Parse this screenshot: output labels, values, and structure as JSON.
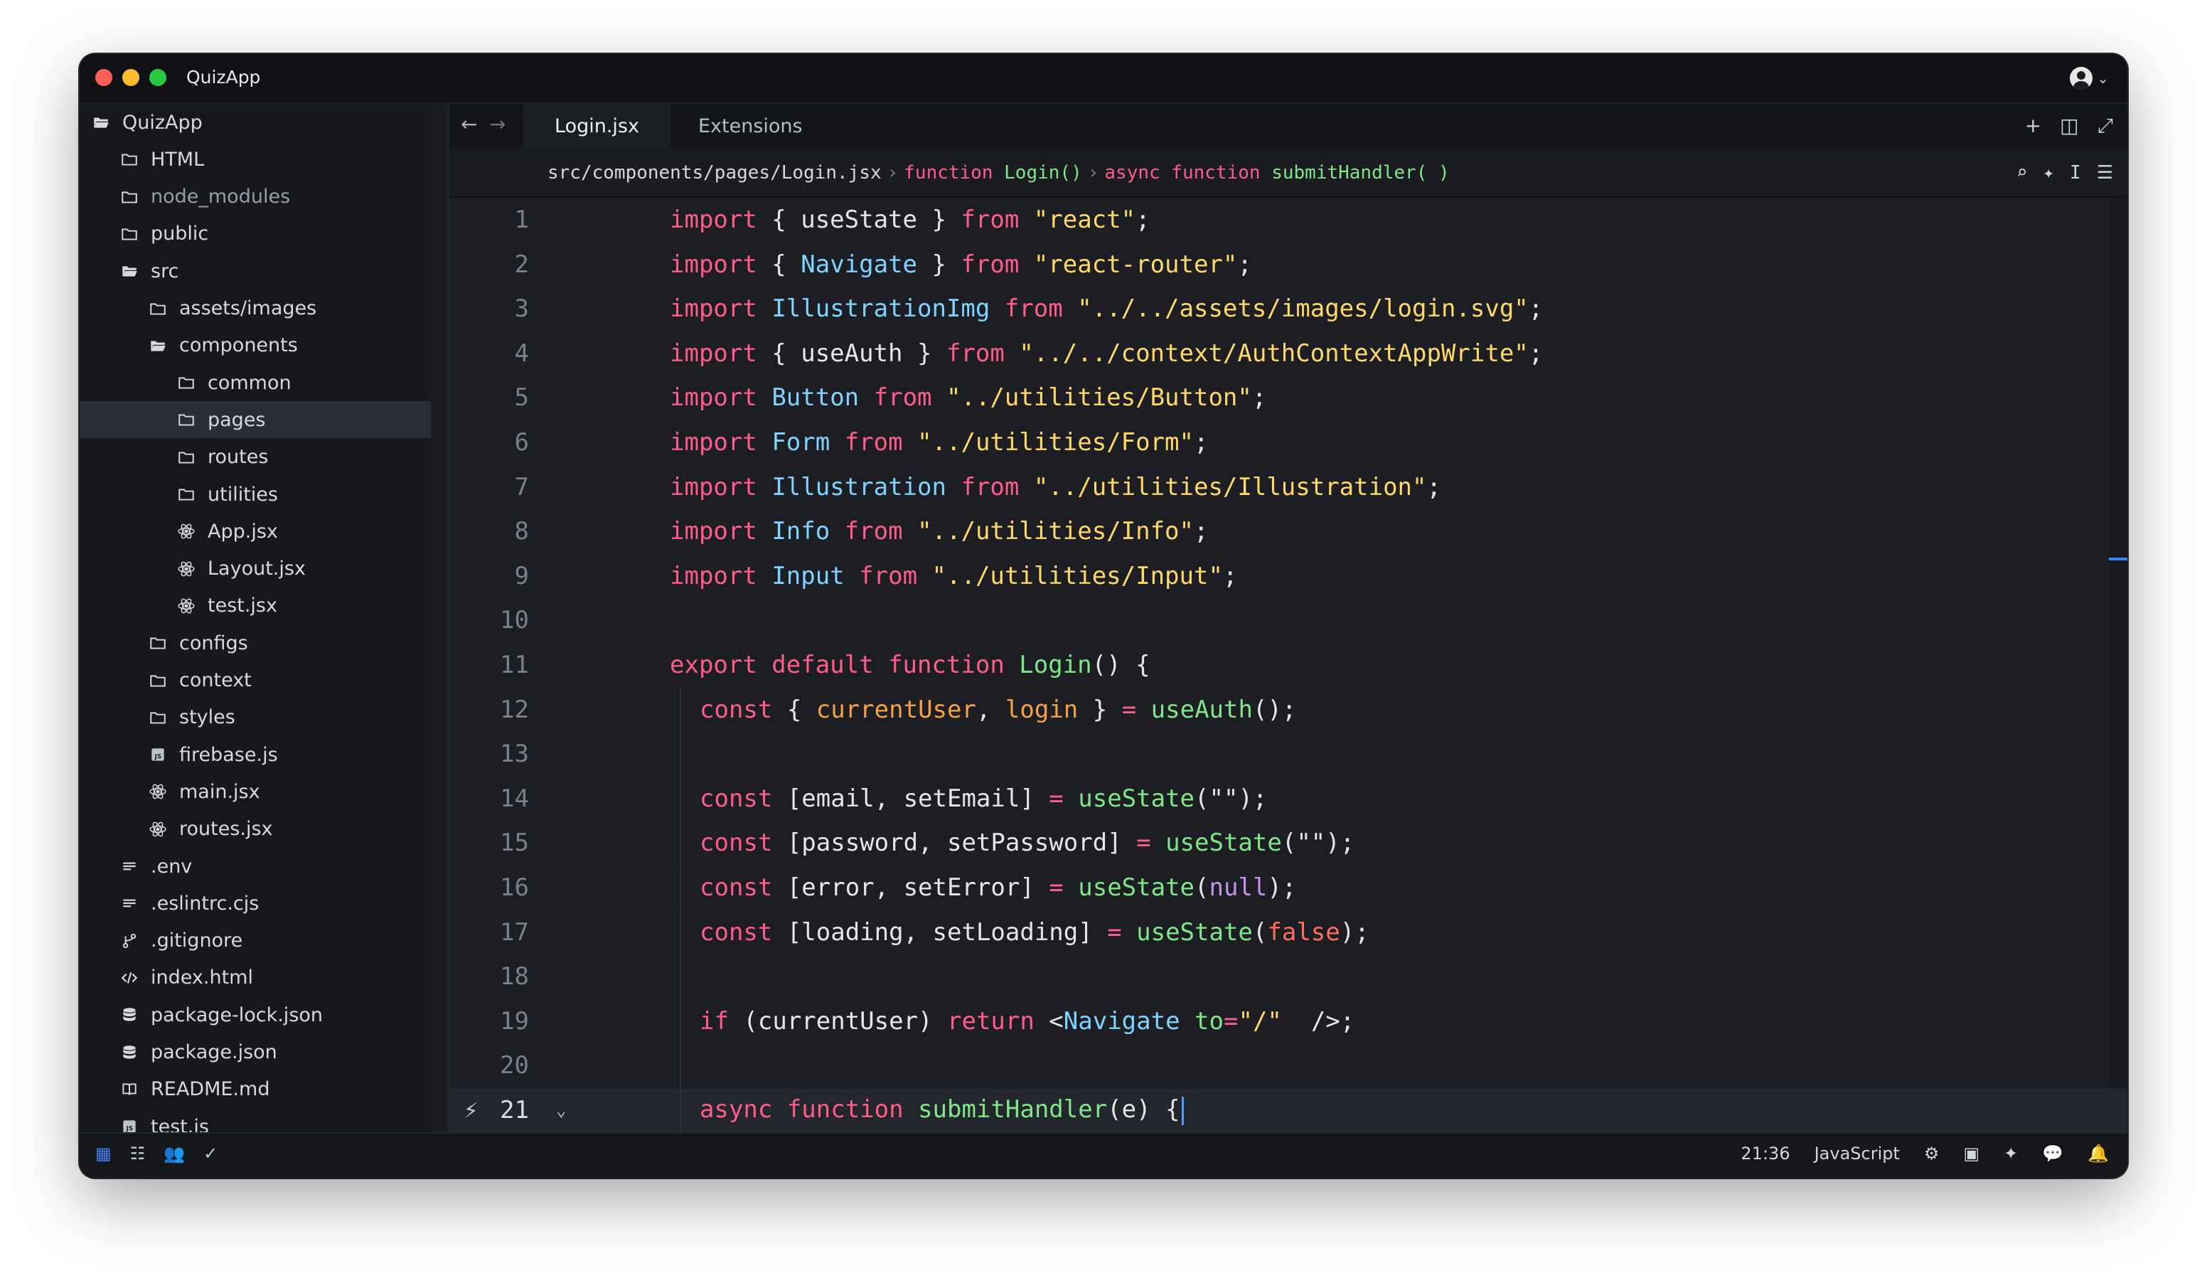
{
  "window": {
    "title": "QuizApp"
  },
  "sidebar": {
    "items": [
      {
        "label": "QuizApp",
        "icon": "folder-open-icon",
        "depth": 0,
        "selected": false
      },
      {
        "label": "HTML",
        "icon": "folder-icon",
        "depth": 1,
        "selected": false
      },
      {
        "label": "node_modules",
        "icon": "folder-icon",
        "depth": 1,
        "selected": false,
        "dim": true
      },
      {
        "label": "public",
        "icon": "folder-icon",
        "depth": 1,
        "selected": false
      },
      {
        "label": "src",
        "icon": "folder-open-icon",
        "depth": 1,
        "selected": false
      },
      {
        "label": "assets/images",
        "icon": "folder-icon",
        "depth": 2,
        "selected": false
      },
      {
        "label": "components",
        "icon": "folder-open-icon",
        "depth": 2,
        "selected": false
      },
      {
        "label": "common",
        "icon": "folder-icon",
        "depth": 3,
        "selected": false
      },
      {
        "label": "pages",
        "icon": "folder-icon",
        "depth": 3,
        "selected": true
      },
      {
        "label": "routes",
        "icon": "folder-icon",
        "depth": 3,
        "selected": false
      },
      {
        "label": "utilities",
        "icon": "folder-icon",
        "depth": 3,
        "selected": false
      },
      {
        "label": "App.jsx",
        "icon": "react-icon",
        "depth": 3,
        "selected": false
      },
      {
        "label": "Layout.jsx",
        "icon": "react-icon",
        "depth": 3,
        "selected": false
      },
      {
        "label": "test.jsx",
        "icon": "react-icon",
        "depth": 3,
        "selected": false
      },
      {
        "label": "configs",
        "icon": "folder-icon",
        "depth": 2,
        "selected": false
      },
      {
        "label": "context",
        "icon": "folder-icon",
        "depth": 2,
        "selected": false
      },
      {
        "label": "styles",
        "icon": "folder-icon",
        "depth": 2,
        "selected": false
      },
      {
        "label": "firebase.js",
        "icon": "js-file-icon",
        "depth": 2,
        "selected": false
      },
      {
        "label": "main.jsx",
        "icon": "react-icon",
        "depth": 2,
        "selected": false
      },
      {
        "label": "routes.jsx",
        "icon": "react-icon",
        "depth": 2,
        "selected": false
      },
      {
        "label": ".env",
        "icon": "text-file-icon",
        "depth": 1,
        "selected": false
      },
      {
        "label": ".eslintrc.cjs",
        "icon": "text-file-icon",
        "depth": 1,
        "selected": false
      },
      {
        "label": ".gitignore",
        "icon": "git-icon",
        "depth": 1,
        "selected": false
      },
      {
        "label": "index.html",
        "icon": "code-icon",
        "depth": 1,
        "selected": false
      },
      {
        "label": "package-lock.json",
        "icon": "database-icon",
        "depth": 1,
        "selected": false
      },
      {
        "label": "package.json",
        "icon": "database-icon",
        "depth": 1,
        "selected": false
      },
      {
        "label": "README.md",
        "icon": "book-icon",
        "depth": 1,
        "selected": false
      },
      {
        "label": "test.js",
        "icon": "js-file-icon",
        "depth": 1,
        "selected": false
      }
    ]
  },
  "tabs": [
    {
      "label": "Login.jsx",
      "active": true
    },
    {
      "label": "Extensions",
      "active": false
    }
  ],
  "breadcrumb": {
    "path": "src/components/pages/Login.jsx",
    "sep": "›",
    "seg1_kw": "function",
    "seg1_fn": "Login()",
    "seg2_kw": "async function",
    "seg2_fn": "submitHandler( )"
  },
  "editor": {
    "current_line": 21,
    "lines": [
      {
        "n": "1",
        "tokens": [
          [
            "kw",
            "import"
          ],
          [
            "pl",
            " { useState } "
          ],
          [
            "kw",
            "from"
          ],
          [
            "pl",
            " "
          ],
          [
            "str",
            "\"react\""
          ],
          [
            "pl",
            ";"
          ]
        ]
      },
      {
        "n": "2",
        "tokens": [
          [
            "kw",
            "import"
          ],
          [
            "pl",
            " { "
          ],
          [
            "id",
            "Navigate"
          ],
          [
            "pl",
            " } "
          ],
          [
            "kw",
            "from"
          ],
          [
            "pl",
            " "
          ],
          [
            "str",
            "\"react-router\""
          ],
          [
            "pl",
            ";"
          ]
        ]
      },
      {
        "n": "3",
        "tokens": [
          [
            "kw",
            "import"
          ],
          [
            "pl",
            " "
          ],
          [
            "id",
            "IllustrationImg"
          ],
          [
            "pl",
            " "
          ],
          [
            "kw",
            "from"
          ],
          [
            "pl",
            " "
          ],
          [
            "str",
            "\"../../assets/images/login.svg\""
          ],
          [
            "pl",
            ";"
          ]
        ]
      },
      {
        "n": "4",
        "tokens": [
          [
            "kw",
            "import"
          ],
          [
            "pl",
            " { useAuth } "
          ],
          [
            "kw",
            "from"
          ],
          [
            "pl",
            " "
          ],
          [
            "str",
            "\"../../context/AuthContextAppWrite\""
          ],
          [
            "pl",
            ";"
          ]
        ]
      },
      {
        "n": "5",
        "tokens": [
          [
            "kw",
            "import"
          ],
          [
            "pl",
            " "
          ],
          [
            "id",
            "Button"
          ],
          [
            "pl",
            " "
          ],
          [
            "kw",
            "from"
          ],
          [
            "pl",
            " "
          ],
          [
            "str",
            "\"../utilities/Button\""
          ],
          [
            "pl",
            ";"
          ]
        ]
      },
      {
        "n": "6",
        "tokens": [
          [
            "kw",
            "import"
          ],
          [
            "pl",
            " "
          ],
          [
            "id",
            "Form"
          ],
          [
            "pl",
            " "
          ],
          [
            "kw",
            "from"
          ],
          [
            "pl",
            " "
          ],
          [
            "str",
            "\"../utilities/Form\""
          ],
          [
            "pl",
            ";"
          ]
        ]
      },
      {
        "n": "7",
        "tokens": [
          [
            "kw",
            "import"
          ],
          [
            "pl",
            " "
          ],
          [
            "id",
            "Illustration"
          ],
          [
            "pl",
            " "
          ],
          [
            "kw",
            "from"
          ],
          [
            "pl",
            " "
          ],
          [
            "str",
            "\"../utilities/Illustration\""
          ],
          [
            "pl",
            ";"
          ]
        ]
      },
      {
        "n": "8",
        "tokens": [
          [
            "kw",
            "import"
          ],
          [
            "pl",
            " "
          ],
          [
            "id",
            "Info"
          ],
          [
            "pl",
            " "
          ],
          [
            "kw",
            "from"
          ],
          [
            "pl",
            " "
          ],
          [
            "str",
            "\"../utilities/Info\""
          ],
          [
            "pl",
            ";"
          ]
        ]
      },
      {
        "n": "9",
        "tokens": [
          [
            "kw",
            "import"
          ],
          [
            "pl",
            " "
          ],
          [
            "id",
            "Input"
          ],
          [
            "pl",
            " "
          ],
          [
            "kw",
            "from"
          ],
          [
            "pl",
            " "
          ],
          [
            "str",
            "\"../utilities/Input\""
          ],
          [
            "pl",
            ";"
          ]
        ]
      },
      {
        "n": "10",
        "tokens": []
      },
      {
        "n": "11",
        "tokens": [
          [
            "kw",
            "export default function"
          ],
          [
            "pl",
            " "
          ],
          [
            "fn",
            "Login"
          ],
          [
            "pl",
            "() {"
          ]
        ]
      },
      {
        "n": "12",
        "indent": true,
        "tokens": [
          [
            "kw",
            "const"
          ],
          [
            "pl",
            " { "
          ],
          [
            "var",
            "currentUser"
          ],
          [
            "pl",
            ", "
          ],
          [
            "var",
            "login"
          ],
          [
            "pl",
            " } "
          ],
          [
            "kw",
            "="
          ],
          [
            "pl",
            " "
          ],
          [
            "fn",
            "useAuth"
          ],
          [
            "pl",
            "();"
          ]
        ]
      },
      {
        "n": "13",
        "indent": true,
        "tokens": []
      },
      {
        "n": "14",
        "indent": true,
        "tokens": [
          [
            "kw",
            "const"
          ],
          [
            "pl",
            " [email, setEmail] "
          ],
          [
            "kw",
            "="
          ],
          [
            "pl",
            " "
          ],
          [
            "fn",
            "useState"
          ],
          [
            "pl",
            "(\"\");"
          ]
        ]
      },
      {
        "n": "15",
        "indent": true,
        "tokens": [
          [
            "kw",
            "const"
          ],
          [
            "pl",
            " [password, setPassword] "
          ],
          [
            "kw",
            "="
          ],
          [
            "pl",
            " "
          ],
          [
            "fn",
            "useState"
          ],
          [
            "pl",
            "(\"\");"
          ]
        ]
      },
      {
        "n": "16",
        "indent": true,
        "tokens": [
          [
            "kw",
            "const"
          ],
          [
            "pl",
            " [error, setError] "
          ],
          [
            "kw",
            "="
          ],
          [
            "pl",
            " "
          ],
          [
            "fn",
            "useState"
          ],
          [
            "pl",
            "("
          ],
          [
            "num",
            "null"
          ],
          [
            "pl",
            ");"
          ]
        ]
      },
      {
        "n": "17",
        "indent": true,
        "tokens": [
          [
            "kw",
            "const"
          ],
          [
            "pl",
            " [loading, setLoading] "
          ],
          [
            "kw",
            "="
          ],
          [
            "pl",
            " "
          ],
          [
            "fn",
            "useState"
          ],
          [
            "pl",
            "("
          ],
          [
            "bool",
            "false"
          ],
          [
            "pl",
            ");"
          ]
        ]
      },
      {
        "n": "18",
        "indent": true,
        "tokens": []
      },
      {
        "n": "19",
        "indent": true,
        "tokens": [
          [
            "kw",
            "if"
          ],
          [
            "pl",
            " (currentUser) "
          ],
          [
            "kw",
            "return"
          ],
          [
            "pl",
            " <"
          ],
          [
            "tag",
            "Navigate"
          ],
          [
            "pl",
            " "
          ],
          [
            "attr",
            "to"
          ],
          [
            "kw",
            "="
          ],
          [
            "str",
            "\"/\""
          ],
          [
            "pl",
            "  />;"
          ]
        ]
      },
      {
        "n": "20",
        "indent": true,
        "tokens": []
      },
      {
        "n": "21",
        "indent": true,
        "current": true,
        "tokens": [
          [
            "kw",
            "async function"
          ],
          [
            "pl",
            " "
          ],
          [
            "fn",
            "submitHandler"
          ],
          [
            "pl",
            "(e) {"
          ]
        ]
      }
    ]
  },
  "status": {
    "cursor_pos": "21:36",
    "language": "JavaScript"
  },
  "colors": {
    "keyword": "#ff5c8a",
    "string": "#ffd866",
    "identifier": "#7fd3ff",
    "function": "#7ee787",
    "variable": "#f5a142",
    "accent": "#3b82f6"
  }
}
